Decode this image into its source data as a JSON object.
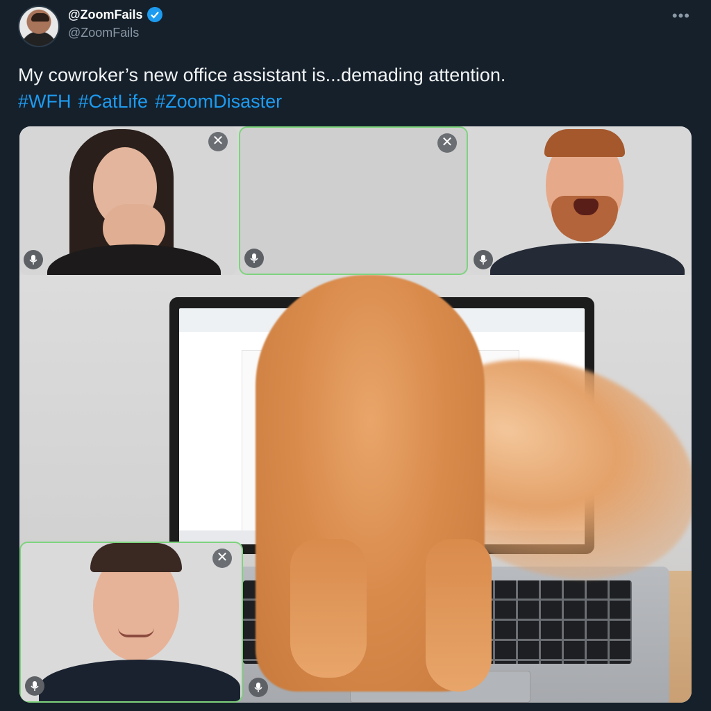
{
  "user": {
    "display_name": "@ZoomFails",
    "handle": "@ZoomFails",
    "verified": true
  },
  "tweet": {
    "text": "My cowroker’s new office assistant is...demading attention.",
    "hashtags": [
      "#WFH",
      "#CatLife",
      "#ZoomDisaster"
    ]
  },
  "icons": {
    "more": "more-options-icon",
    "verified": "verified-badge-icon",
    "close": "close-icon",
    "mic": "microphone-icon"
  },
  "colors": {
    "background": "#15202b",
    "link": "#1d9bf0",
    "secondary_text": "#8b98a5",
    "active_speaker_border": "#7ed37e"
  },
  "video_call": {
    "close_glyph": "✕",
    "more_glyph": "•••"
  }
}
